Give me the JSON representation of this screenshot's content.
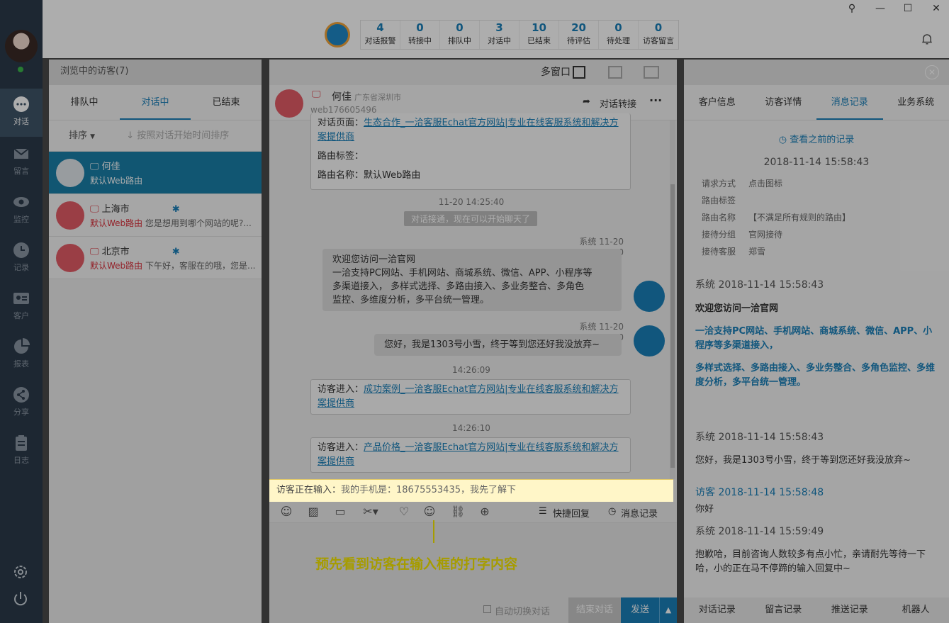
{
  "nav": {
    "active_label": "对话",
    "items": [
      "留言",
      "监控",
      "记录",
      "客户",
      "报表",
      "分享",
      "日志"
    ]
  },
  "stats": [
    {
      "n": "4",
      "l": "对话报警"
    },
    {
      "n": "0",
      "l": "转接中"
    },
    {
      "n": "0",
      "l": "排队中"
    },
    {
      "n": "3",
      "l": "对话中"
    },
    {
      "n": "10",
      "l": "已结束"
    },
    {
      "n": "20",
      "l": "待评估"
    },
    {
      "n": "0",
      "l": "待处理"
    },
    {
      "n": "0",
      "l": "访客留言"
    }
  ],
  "visitors": {
    "title": "浏览中的访客(7)",
    "tabs": [
      "排队中",
      "对话中",
      "已结束"
    ],
    "sort_label": "排序",
    "sort_hint": "按照对话开始时间排序",
    "items": [
      {
        "name": "何佳",
        "route": "默认Web路由",
        "msg": ""
      },
      {
        "name": "上海市",
        "route": "默认Web路由",
        "msg": "您是想用到哪个网站的呢?..."
      },
      {
        "name": "北京市",
        "route": "默认Web路由",
        "msg": "下午好，客服在的哦，您是..."
      }
    ]
  },
  "chat": {
    "multi_window": "多窗口",
    "visitor_name": "何佳",
    "visitor_location": "广东省深圳市",
    "visitor_id": "web176605496",
    "transfer": "对话转接",
    "page_label": "对话页面：",
    "page_link": "生态合作_一洽客服Echat官方网站|专业在线客服系统和解决方案提供商",
    "route_tag": "路由标签：",
    "route_name": "路由名称：默认Web路由",
    "t1": "11-20 14:25:40",
    "connected": "对话接通，现在可以开始聊天了",
    "sys1": "系统  11-20 14:25:40",
    "welcome_lines": [
      "欢迎您访问一洽官网",
      "一洽支持PC网站、手机网站、商城系统、微信、APP、小程序等",
      "多渠道接入， 多样式选择、多路由接入、多业务整合、多角色",
      "监控、多维度分析，多平台统一管理。"
    ],
    "sys2": "系统  11-20 14:25:40",
    "greet": "您好，我是1303号小雪，终于等到您还好我没放弃~",
    "t2": "14:26:09",
    "enter_label": "访客进入：",
    "enter1_link": "成功案例_一洽客服Echat官方网站|专业在线客服系统和解决方案提供商",
    "t3": "14:26:10",
    "enter2_link": "产品价格_一洽客服Echat官方网站|专业在线客服系统和解决方案提供商",
    "typing_label": "访客正在输入：",
    "typing_text": "我的手机是：18675553435，我先了解下",
    "quick_reply": "快捷回复",
    "msg_record": "消息记录",
    "annotation": "预先看到访客在输入框的打字内容",
    "auto_switch": "自动切换对话",
    "end_chat": "结束对话",
    "send": "发送"
  },
  "right": {
    "tabs": [
      "客户信息",
      "访客详情",
      "消息记录",
      "业务系统"
    ],
    "view_prev": "查看之前的记录",
    "date": "2018-11-14 15:58:43",
    "kv": [
      {
        "k": "请求方式",
        "v": "点击图标"
      },
      {
        "k": "路由标签",
        "v": ""
      },
      {
        "k": "路由名称",
        "v": "【不满足所有规则的路由】"
      },
      {
        "k": "接待分组",
        "v": "官网接待"
      },
      {
        "k": "接待客服",
        "v": "郑雪"
      }
    ],
    "sys_a": "系统  2018-11-14 15:58:43",
    "welcome": "欢迎您访问一洽官网",
    "blue1": "一洽支持PC网站、手机网站、商城系统、微信、APP、小程序等多渠道接入，",
    "blue2": "多样式选择、多路由接入、多业务整合、多角色监控、多维度分析，多平台统一管理。",
    "sys_b": "系统  2018-11-14 15:58:43",
    "greet": "您好，我是1303号小雪，终于等到您还好我没放弃~",
    "visitor_head": "访客",
    "visitor_time": "2018-11-14 15:58:48",
    "visitor_msg": "你好",
    "sys_c": "系统  2018-11-14 15:59:49",
    "sorry": "抱歉哈，目前咨询人数较多有点小忙，亲请耐先等待一下哈，小的正在马不停蹄的输入回复中~",
    "bottom_tabs": [
      "对话记录",
      "留言记录",
      "推送记录",
      "机器人"
    ]
  }
}
